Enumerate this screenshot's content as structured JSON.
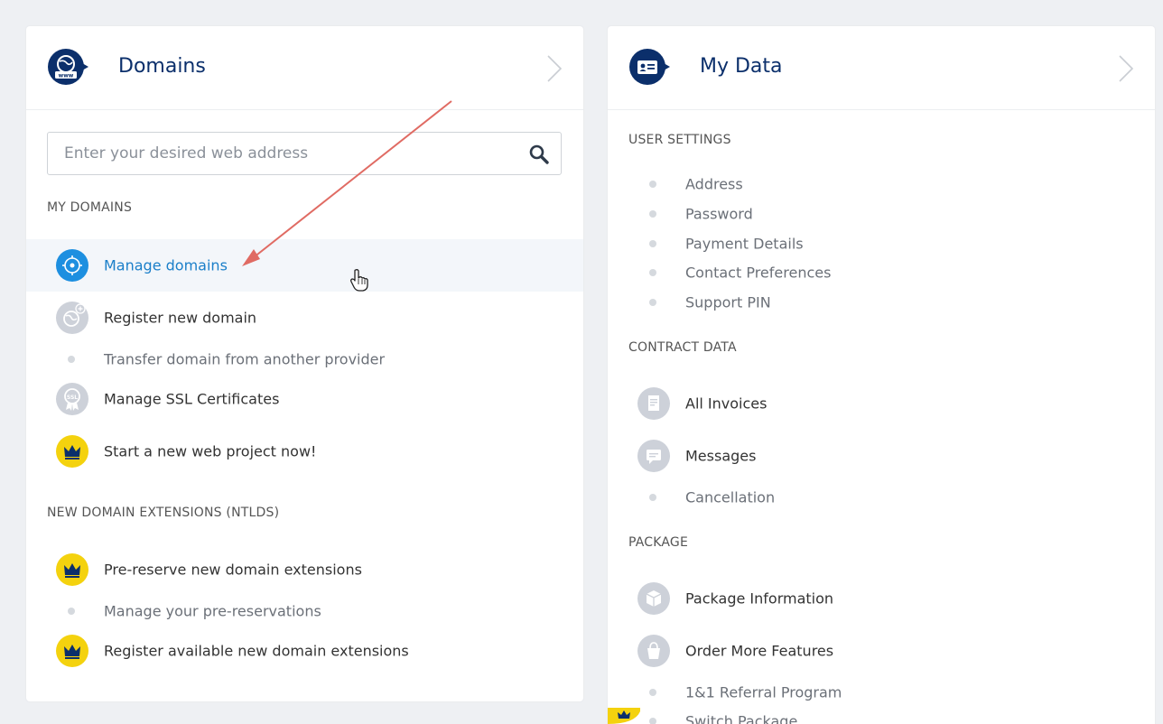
{
  "domains": {
    "title": "Domains",
    "search": {
      "placeholder": "Enter your desired web address",
      "value": ""
    },
    "my_domains": {
      "title": "MY DOMAINS",
      "items": [
        {
          "label": "Manage domains",
          "icon": "globe-pointer-icon",
          "state": "hover"
        },
        {
          "label": "Register new domain",
          "icon": "globe-plus-icon"
        },
        {
          "label": "Transfer domain from another provider",
          "icon": "bullet"
        },
        {
          "label": "Manage SSL Certificates",
          "icon": "ssl-badge-icon"
        },
        {
          "label": "Start a new web project now!",
          "icon": "crown-icon"
        }
      ]
    },
    "ntlds": {
      "title": "NEW DOMAIN EXTENSIONS (NTLDS)",
      "items": [
        {
          "label": "Pre-reserve new domain extensions",
          "icon": "crown-icon"
        },
        {
          "label": "Manage your pre-reservations",
          "icon": "bullet"
        },
        {
          "label": "Register available new domain extensions",
          "icon": "crown-icon"
        }
      ]
    }
  },
  "my_data": {
    "title": "My Data",
    "user_settings": {
      "title": "USER SETTINGS",
      "items": [
        "Address",
        "Password",
        "Payment Details",
        "Contact Preferences",
        "Support PIN"
      ]
    },
    "contract_data": {
      "title": "CONTRACT DATA",
      "items": [
        {
          "label": "All Invoices",
          "icon": "invoice-icon"
        },
        {
          "label": "Messages",
          "icon": "message-icon"
        },
        {
          "label": "Cancellation",
          "icon": "bullet"
        }
      ]
    },
    "package": {
      "title": "PACKAGE",
      "items": [
        {
          "label": "Package Information",
          "icon": "package-box-icon"
        },
        {
          "label": "Order More Features",
          "icon": "shopping-bag-icon"
        },
        {
          "label": "1&1 Referral Program",
          "icon": "bullet"
        },
        {
          "label": "Switch Package",
          "icon": "bullet"
        }
      ]
    }
  },
  "colors": {
    "navy": "#0b2f6b",
    "link_blue": "#1b7fc9",
    "crown_yellow": "#f4d20e",
    "annotation_arrow": "#e06b63"
  }
}
